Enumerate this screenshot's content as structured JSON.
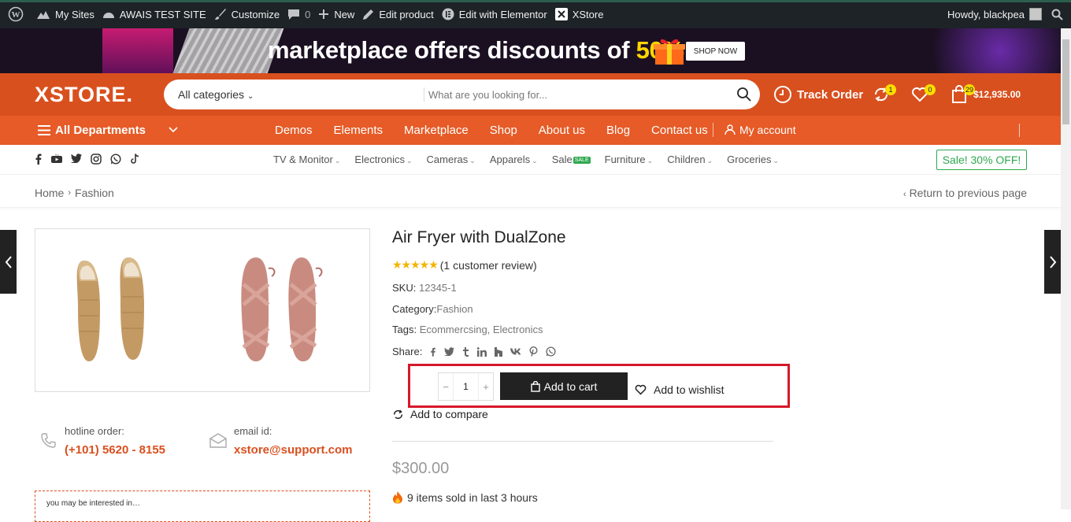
{
  "admin_bar": {
    "items": [
      "My Sites",
      "AWAIS TEST SITE",
      "Customize",
      "0",
      "New",
      "Edit product",
      "Edit with Elementor",
      "XStore"
    ],
    "howdy": "Howdy, blackpea"
  },
  "banner": {
    "title": "marketplace offers discounts of ",
    "percent": "50%",
    "button": "SHOP NOW"
  },
  "header": {
    "logo": "XSTORE.",
    "search_category": "All categories",
    "search_placeholder": "What are you looking for...",
    "track_order": "Track Order",
    "compare_count": "1",
    "wishlist_count": "0",
    "cart_count": "29",
    "cart_amount": "$12,935.00"
  },
  "nav": {
    "departments": "All Departments",
    "links": [
      "Demos",
      "Elements",
      "Marketplace",
      "Shop",
      "About us",
      "Blog",
      "Contact us"
    ],
    "account": "My account"
  },
  "category_bar": {
    "items": [
      "TV & Monitor",
      "Electronics",
      "Cameras",
      "Apparels",
      "Sale",
      "Furniture",
      "Children",
      "Groceries"
    ],
    "sale_tag": "SALE",
    "sale_button": "Sale! 30% OFF!"
  },
  "breadcrumb": {
    "home": "Home",
    "current": "Fashion",
    "back": "Return to previous page"
  },
  "product": {
    "title": "Air Fryer with DualZone",
    "rating_stars": 5,
    "review_text": "(1 customer review)",
    "sku_label": "SKU:",
    "sku": "12345-1",
    "category_label": "Category:",
    "category": "Fashion",
    "tags_label": "Tags:",
    "tags": "Ecommercsing, Electronics",
    "share_label": "Share:",
    "quantity": "1",
    "add_to_cart": "Add to cart",
    "add_to_wishlist": "Add to wishlist",
    "add_to_compare": "Add to compare",
    "price": "$300.00",
    "sold_text": "9 items sold in last 3 hours"
  },
  "contacts": {
    "hotline_label": "hotline order:",
    "hotline": "(+101) 5620 - 8155",
    "email_label": "email id:",
    "email": "xstore@support.com"
  },
  "interest_text": "you may be interested in…",
  "colors": {
    "brand_orange": "#d9501f",
    "nav_orange": "#e65b27",
    "highlight_red": "#d6182a",
    "sale_green": "#2fa84f"
  }
}
